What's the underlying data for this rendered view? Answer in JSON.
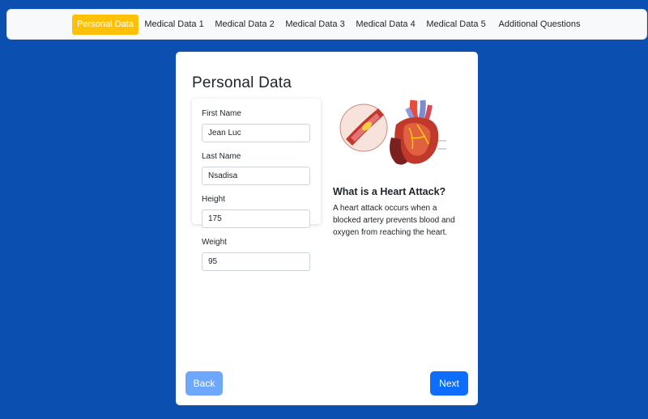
{
  "nav": {
    "tabs": [
      {
        "label": "Personal Data",
        "active": true
      },
      {
        "label": "Medical Data 1",
        "active": false
      },
      {
        "label": "Medical Data 2",
        "active": false
      },
      {
        "label": "Medical Data 3",
        "active": false
      },
      {
        "label": "Medical Data 4",
        "active": false
      },
      {
        "label": "Medical Data 5",
        "active": false
      },
      {
        "label": "Additional Questions",
        "active": false
      }
    ]
  },
  "page": {
    "title": "Personal Data"
  },
  "form": {
    "first_name": {
      "label": "First Name",
      "value": "Jean Luc"
    },
    "last_name": {
      "label": "Last Name",
      "value": "Nsadisa"
    },
    "height": {
      "label": "Height",
      "value": "175"
    },
    "weight": {
      "label": "Weight",
      "value": "95"
    }
  },
  "info": {
    "title": "What is a Heart Attack?",
    "text": "A heart attack occurs when a blocked artery prevents blood and oxygen from reaching the heart."
  },
  "buttons": {
    "back": "Back",
    "next": "Next"
  },
  "colors": {
    "background": "#0b4fb0",
    "active_tab": "#ffc107",
    "primary": "#0d6efd",
    "primary_disabled": "#6ea8fe"
  }
}
